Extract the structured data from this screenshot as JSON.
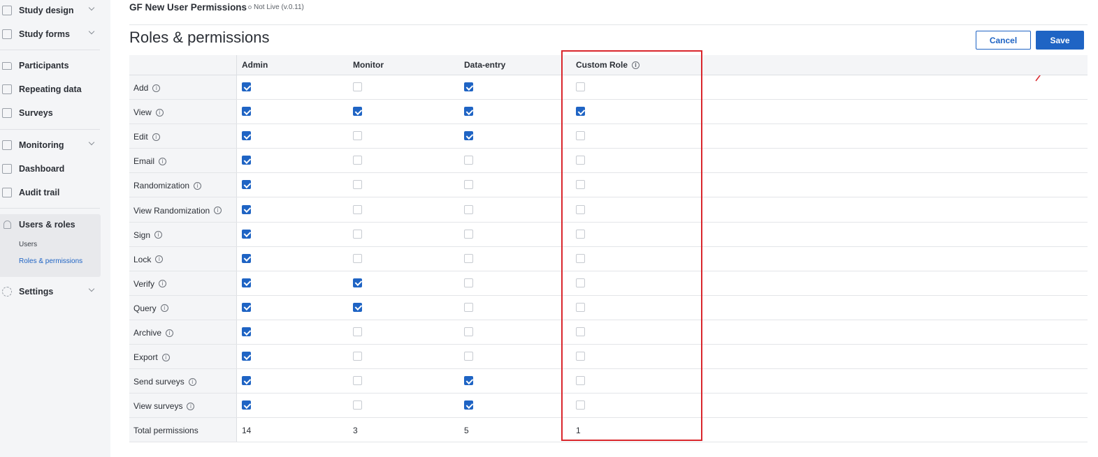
{
  "sidebar": {
    "items": [
      {
        "label": "Study design",
        "icon": "sitemap-icon",
        "chevron": true
      },
      {
        "label": "Study forms",
        "icon": "form-icon",
        "chevron": true
      },
      {
        "label": "Participants",
        "icon": "folder-icon",
        "chevron": false
      },
      {
        "label": "Repeating data",
        "icon": "document-icon",
        "chevron": false
      },
      {
        "label": "Surveys",
        "icon": "survey-icon",
        "chevron": false
      },
      {
        "label": "Monitoring",
        "icon": "monitoring-icon",
        "chevron": true
      },
      {
        "label": "Dashboard",
        "icon": "chart-icon",
        "chevron": false
      },
      {
        "label": "Audit trail",
        "icon": "audit-icon",
        "chevron": false
      },
      {
        "label": "Users & roles",
        "icon": "person-icon",
        "chevron": false
      },
      {
        "label": "Settings",
        "icon": "gear-icon",
        "chevron": true
      }
    ],
    "subitems": [
      {
        "label": "Users",
        "active": false
      },
      {
        "label": "Roles & permissions",
        "active": true
      }
    ]
  },
  "header": {
    "study_name": "GF New User Permissions",
    "status": "Not Live (v.0.11)",
    "page_title": "Roles & permissions",
    "cancel_label": "Cancel",
    "save_label": "Save"
  },
  "table": {
    "columns": [
      "Admin",
      "Monitor",
      "Data-entry",
      "Custom Role"
    ],
    "rows": [
      {
        "label": "Add",
        "values": [
          true,
          false,
          true,
          false
        ]
      },
      {
        "label": "View",
        "values": [
          true,
          true,
          true,
          true
        ]
      },
      {
        "label": "Edit",
        "values": [
          true,
          false,
          true,
          false
        ]
      },
      {
        "label": "Email",
        "values": [
          true,
          false,
          false,
          false
        ]
      },
      {
        "label": "Randomization",
        "values": [
          true,
          false,
          false,
          false
        ]
      },
      {
        "label": "View Randomization",
        "values": [
          true,
          false,
          false,
          false
        ]
      },
      {
        "label": "Sign",
        "values": [
          true,
          false,
          false,
          false
        ]
      },
      {
        "label": "Lock",
        "values": [
          true,
          false,
          false,
          false
        ]
      },
      {
        "label": "Verify",
        "values": [
          true,
          true,
          false,
          false
        ]
      },
      {
        "label": "Query",
        "values": [
          true,
          true,
          false,
          false
        ]
      },
      {
        "label": "Archive",
        "values": [
          true,
          false,
          false,
          false
        ]
      },
      {
        "label": "Export",
        "values": [
          true,
          false,
          false,
          false
        ]
      },
      {
        "label": "Send surveys",
        "values": [
          true,
          false,
          true,
          false
        ]
      },
      {
        "label": "View surveys",
        "values": [
          true,
          false,
          true,
          false
        ]
      }
    ],
    "totals_label": "Total permissions",
    "totals": [
      "14",
      "3",
      "5",
      "1"
    ]
  },
  "colors": {
    "accent": "#1f64c4",
    "highlight": "#d9262c"
  }
}
